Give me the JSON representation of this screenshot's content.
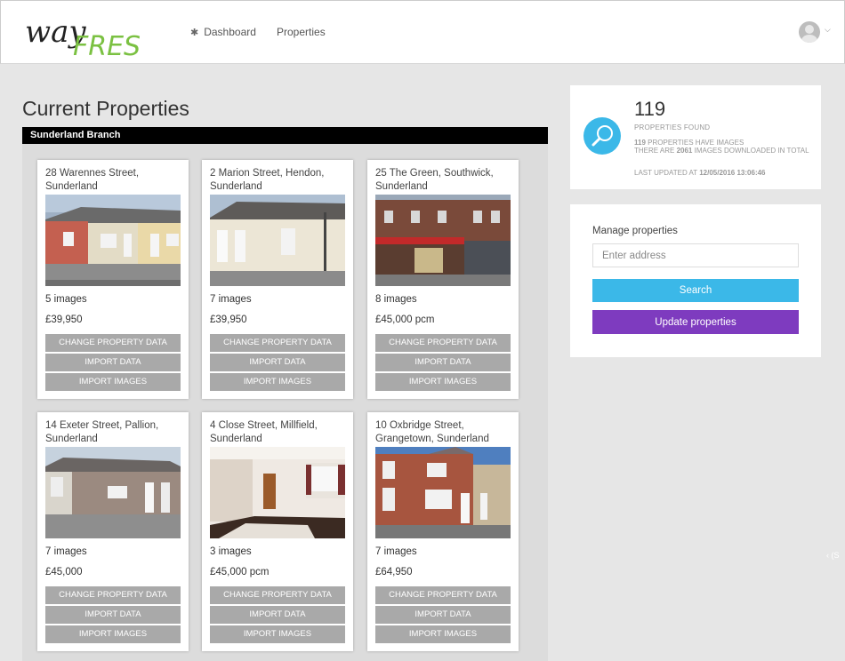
{
  "header": {
    "logo_text_dark": "way",
    "logo_text_green": "FRESH",
    "nav": [
      {
        "label": "Dashboard",
        "icon": "gear-icon"
      },
      {
        "label": "Properties"
      }
    ],
    "user_menu_icon": "user-avatar-icon"
  },
  "main": {
    "title": "Current Properties",
    "branch": "Sunderland Branch",
    "properties": [
      {
        "address": "28 Warennes Street, Sunderland",
        "images": "5 images",
        "price": "£39,950"
      },
      {
        "address": "2 Marion Street, Hendon, Sunderland",
        "images": "7 images",
        "price": "£39,950"
      },
      {
        "address": "25 The Green, Southwick, Sunderland",
        "images": "8 images",
        "price": "£45,000 pcm"
      },
      {
        "address": "14 Exeter Street, Pallion, Sunderland",
        "images": "7 images",
        "price": "£45,000"
      },
      {
        "address": "4 Close Street, Millfield, Sunderland",
        "images": "3 images",
        "price": "£45,000 pcm"
      },
      {
        "address": "10 Oxbridge Street, Grangetown, Sunderland",
        "images": "7 images",
        "price": "£64,950"
      }
    ],
    "buttons": {
      "change": "CHANGE PROPERTY DATA",
      "import": "IMPORT DATA",
      "images": "IMPORT IMAGES"
    }
  },
  "stats": {
    "count": "119",
    "found_label": "PROPERTIES FOUND",
    "have_images_count": "119",
    "have_images_label": "PROPERTIES HAVE IMAGES",
    "total_prefix": "THERE ARE",
    "total_count": "2061",
    "total_suffix": "IMAGES DOWNLOADED IN TOTAL",
    "updated_label": "LAST UPDATED AT",
    "updated_value": "12/05/2016 13:06:46",
    "icon": "magnifier-icon",
    "accent": "#3bb8e8"
  },
  "manage": {
    "label": "Manage properties",
    "address_placeholder": "Enter address",
    "address_value": "",
    "search_label": "Search",
    "update_label": "Update properties",
    "update_color": "#7e3bbf"
  },
  "side_text": "‹ (S"
}
